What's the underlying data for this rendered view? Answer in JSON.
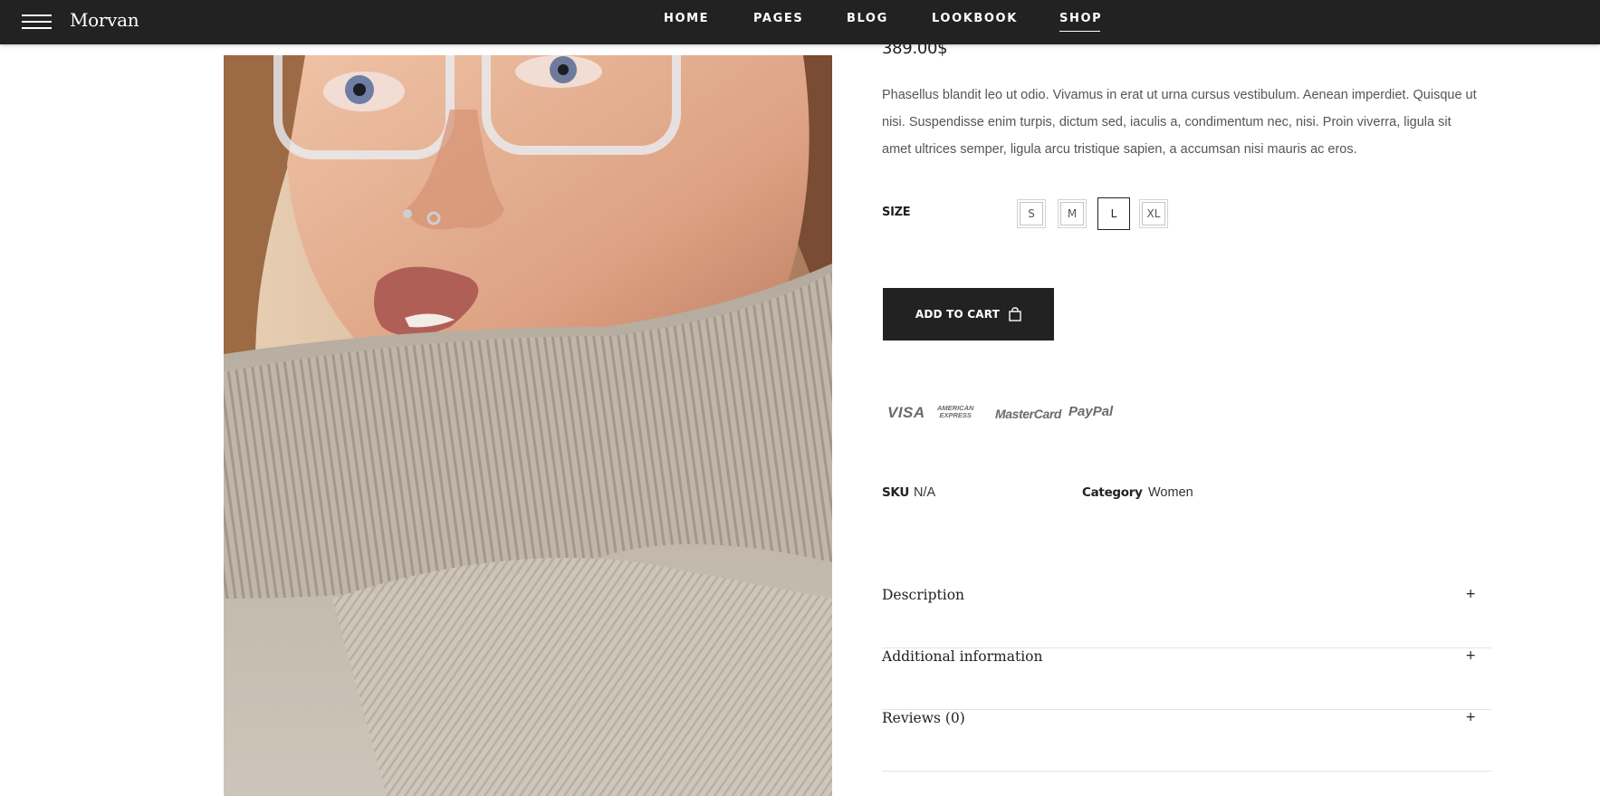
{
  "header": {
    "logo": "Morvan",
    "nav": [
      {
        "label": "HOME"
      },
      {
        "label": "PAGES"
      },
      {
        "label": "BLOG"
      },
      {
        "label": "LOOKBOOK"
      },
      {
        "label": "SHOP",
        "active": true
      }
    ]
  },
  "product": {
    "price": "389.00$",
    "description": "Phasellus blandit leo ut odio. Vivamus in erat ut urna cursus vestibulum. Aenean imperdiet. Quisque ut nisi. Suspendisse enim turpis, dictum sed, iaculis a, condimentum nec, nisi. Proin viverra, ligula sit amet ultrices semper, ligula arcu tristique sapien, a accumsan nisi mauris ac eros.",
    "size_label": "SIZE",
    "sizes": [
      "S",
      "M",
      "L",
      "XL"
    ],
    "selected_size": "L",
    "add_to_cart": "ADD TO CART",
    "payments": {
      "visa": "VISA",
      "amex_line1": "AMERICAN",
      "amex_line2": "EXPRESS",
      "mastercard": "MasterCard",
      "paypal": "PayPal"
    },
    "meta": {
      "sku_label": "SKU",
      "sku_value": "N/A",
      "category_label": "Category",
      "category_value": "Women"
    },
    "accordions": [
      {
        "title": "Description",
        "icon": "+"
      },
      {
        "title": "Additional information",
        "icon": "+"
      },
      {
        "title": "Reviews (0)",
        "icon": "+"
      }
    ]
  },
  "colors": {
    "header_bg": "#222222",
    "button_bg": "#222222",
    "text_muted": "#555555",
    "divider": "#e4e4e4"
  }
}
